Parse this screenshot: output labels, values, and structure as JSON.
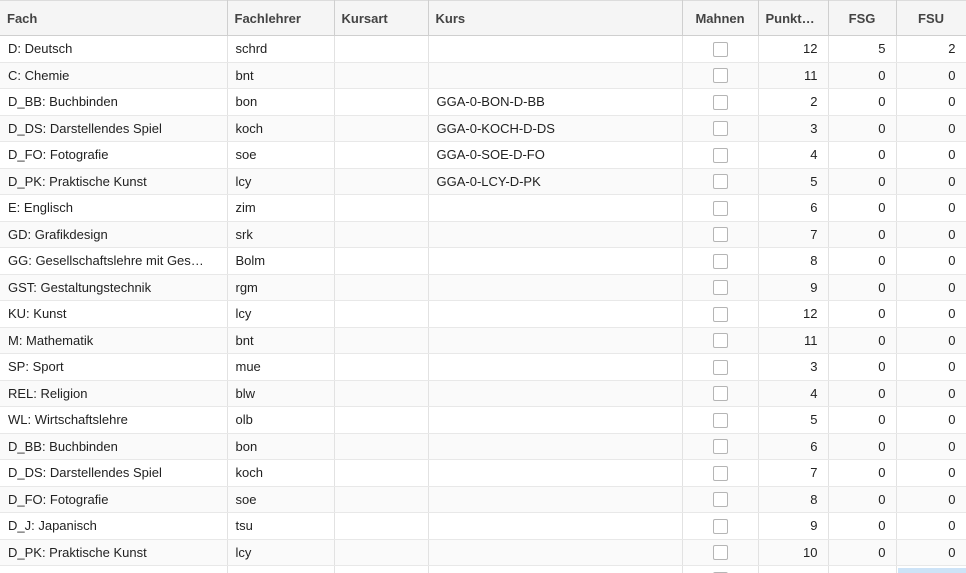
{
  "columns": {
    "fach": "Fach",
    "fachlehrer": "Fachlehrer",
    "kursart": "Kursart",
    "kurs": "Kurs",
    "mahnen": "Mahnen",
    "punkte": "Punkt…",
    "fsg": "FSG",
    "fsu": "FSU"
  },
  "rows": [
    {
      "fach": "D: Deutsch",
      "lehrer": "schrd",
      "kursart": "",
      "kurs": "",
      "punkte": "12",
      "fsg": "5",
      "fsu": "2"
    },
    {
      "fach": "C: Chemie",
      "lehrer": "bnt",
      "kursart": "",
      "kurs": "",
      "punkte": "11",
      "fsg": "0",
      "fsu": "0"
    },
    {
      "fach": "D_BB: Buchbinden",
      "lehrer": "bon",
      "kursart": "",
      "kurs": "GGA-0-BON-D-BB",
      "punkte": "2",
      "fsg": "0",
      "fsu": "0"
    },
    {
      "fach": "D_DS: Darstellendes Spiel",
      "lehrer": "koch",
      "kursart": "",
      "kurs": "GGA-0-KOCH-D-DS",
      "punkte": "3",
      "fsg": "0",
      "fsu": "0"
    },
    {
      "fach": "D_FO: Fotografie",
      "lehrer": "soe",
      "kursart": "",
      "kurs": "GGA-0-SOE-D-FO",
      "punkte": "4",
      "fsg": "0",
      "fsu": "0"
    },
    {
      "fach": "D_PK: Praktische Kunst",
      "lehrer": "lcy",
      "kursart": "",
      "kurs": "GGA-0-LCY-D-PK",
      "punkte": "5",
      "fsg": "0",
      "fsu": "0"
    },
    {
      "fach": "E: Englisch",
      "lehrer": "zim",
      "kursart": "",
      "kurs": "",
      "punkte": "6",
      "fsg": "0",
      "fsu": "0"
    },
    {
      "fach": "GD: Grafikdesign",
      "lehrer": "srk",
      "kursart": "",
      "kurs": "",
      "punkte": "7",
      "fsg": "0",
      "fsu": "0"
    },
    {
      "fach": "GG: Gesellschaftslehre mit Ges…",
      "lehrer": "Bolm",
      "kursart": "",
      "kurs": "",
      "punkte": "8",
      "fsg": "0",
      "fsu": "0"
    },
    {
      "fach": "GST: Gestaltungstechnik",
      "lehrer": "rgm",
      "kursart": "",
      "kurs": "",
      "punkte": "9",
      "fsg": "0",
      "fsu": "0"
    },
    {
      "fach": "KU: Kunst",
      "lehrer": "lcy",
      "kursart": "",
      "kurs": "",
      "punkte": "12",
      "fsg": "0",
      "fsu": "0"
    },
    {
      "fach": "M: Mathematik",
      "lehrer": "bnt",
      "kursart": "",
      "kurs": "",
      "punkte": "11",
      "fsg": "0",
      "fsu": "0"
    },
    {
      "fach": "SP: Sport",
      "lehrer": "mue",
      "kursart": "",
      "kurs": "",
      "punkte": "3",
      "fsg": "0",
      "fsu": "0"
    },
    {
      "fach": "REL: Religion",
      "lehrer": "blw",
      "kursart": "",
      "kurs": "",
      "punkte": "4",
      "fsg": "0",
      "fsu": "0"
    },
    {
      "fach": "WL: Wirtschaftslehre",
      "lehrer": "olb",
      "kursart": "",
      "kurs": "",
      "punkte": "5",
      "fsg": "0",
      "fsu": "0"
    },
    {
      "fach": "D_BB: Buchbinden",
      "lehrer": "bon",
      "kursart": "",
      "kurs": "",
      "punkte": "6",
      "fsg": "0",
      "fsu": "0"
    },
    {
      "fach": "D_DS: Darstellendes Spiel",
      "lehrer": "koch",
      "kursart": "",
      "kurs": "",
      "punkte": "7",
      "fsg": "0",
      "fsu": "0"
    },
    {
      "fach": "D_FO: Fotografie",
      "lehrer": "soe",
      "kursart": "",
      "kurs": "",
      "punkte": "8",
      "fsg": "0",
      "fsu": "0"
    },
    {
      "fach": "D_J: Japanisch",
      "lehrer": "tsu",
      "kursart": "",
      "kurs": "",
      "punkte": "9",
      "fsg": "0",
      "fsu": "0"
    },
    {
      "fach": "D_PK: Praktische Kunst",
      "lehrer": "lcy",
      "kursart": "",
      "kurs": "",
      "punkte": "10",
      "fsg": "0",
      "fsu": "0"
    },
    {
      "fach": "",
      "lehrer": "",
      "kursart": "",
      "kurs": "",
      "punkte": "",
      "fsg": "",
      "fsu": ""
    }
  ]
}
